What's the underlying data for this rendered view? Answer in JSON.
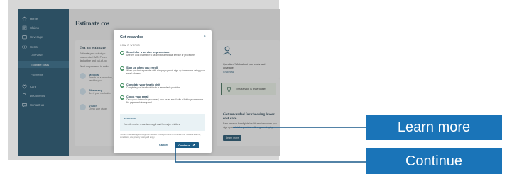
{
  "colors": {
    "sidebar": "#1b4f6b",
    "accent": "#1b5c85",
    "callout": "#1a74b8",
    "connector": "#1a5a8a",
    "success": "#3a8a5a"
  },
  "sidebar": {
    "items": [
      {
        "label": "Home",
        "icon": "home-icon"
      },
      {
        "label": "Claims",
        "icon": "claims-icon"
      },
      {
        "label": "Coverage",
        "icon": "coverage-icon"
      },
      {
        "label": "Costs",
        "icon": "costs-icon"
      }
    ],
    "sub_items": [
      {
        "label": "Overview"
      },
      {
        "label": "Estimate costs"
      },
      {
        "label": "Payments"
      }
    ],
    "bottom_items": [
      {
        "label": "Care",
        "icon": "heart-icon"
      },
      {
        "label": "Documents",
        "icon": "documents-icon"
      },
      {
        "label": "Contact us",
        "icon": "chat-icon"
      }
    ]
  },
  "main": {
    "title": "Estimate cos",
    "estimate_card": {
      "title": "Get an estimate",
      "lines": [
        "Estimate your out-of-po",
        "treatments. HMO, Prefer",
        "deductible and out-of-po"
      ],
      "prompt": "What do you want to estim",
      "services": [
        {
          "name": "Medical",
          "desc": "Search for a procedure, need for you."
        },
        {
          "name": "Pharmacy",
          "desc": "See if your medication"
        },
        {
          "name": "Vision",
          "desc": "Check your vision"
        }
      ]
    },
    "question_card": {
      "text": "Questions? Ask about your costs and coverage",
      "link": "Chat now"
    },
    "reward_card": {
      "badge": "This service is rewardable!",
      "title": "Get rewarded for choosing lower cost care",
      "desc": "Earn rewards for eligible health services when you sign up and visit a provider with a green trophy.",
      "button": "Learn more"
    }
  },
  "modal": {
    "title": "Get rewarded",
    "close_label": "×",
    "kicker": "HOW IT WORKS",
    "steps": [
      {
        "title": "Search for a service or procedure",
        "desc": "Use the Cost Estimator to search for a medical service or procedure."
      },
      {
        "title": "Sign up when you enroll",
        "desc": "When you find a provider with a trophy symbol, sign up for rewards using your email address."
      },
      {
        "title": "Complete your health visit",
        "desc": "Complete your health visit with a rewardable provider."
      },
      {
        "title": "Check your email",
        "desc": "Once your claimed is processed, look for an email with a link to your rewards. No paperwork is required."
      }
    ],
    "rewards": {
      "kicker": "REWARDS",
      "text": "You will receive rewards on a gift card for major retailers"
    },
    "note": "You are now leaving the Regence website. Once you select \"Continue\" the new site's terms, conditions, and privacy policy will apply.",
    "cancel": "Cancel",
    "continue": "Continue"
  },
  "callouts": {
    "learn_more": "Learn more",
    "continue": "Continue"
  }
}
